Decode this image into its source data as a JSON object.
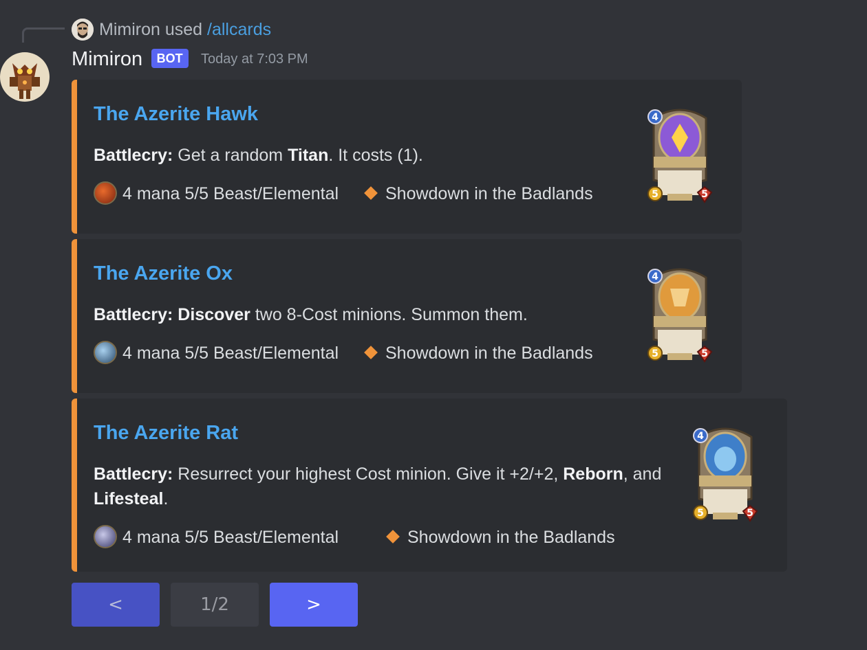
{
  "interaction": {
    "user_name": "Mimiron",
    "used_text": "used",
    "command": "/allcards"
  },
  "message": {
    "author": "Mimiron",
    "bot_tag": "BOT",
    "timestamp": "Today at 7:03 PM"
  },
  "colors": {
    "embed_accent": "#f0933a",
    "title_link": "#4aa6ef",
    "blurple": "#5865f2",
    "background": "#313338",
    "embed_bg": "#2b2d31"
  },
  "embeds": [
    {
      "title": "The Azerite Hawk",
      "desc_bold_1": "Battlecry:",
      "desc_text_1": " Get a random ",
      "desc_bold_2": "Titan",
      "desc_text_2": ". It costs (1).",
      "stats": "4 mana 5/5 Beast/Elemental",
      "set": "Showdown in the Badlands",
      "card": {
        "name": "The Azerite Hawk",
        "cost": "4",
        "attack": "5",
        "health": "5",
        "race": "Elemental Beast",
        "text": "Battlecry: Get a random Titan. It costs (1).",
        "art_color": "#8c5ad6"
      }
    },
    {
      "title": "The Azerite Ox",
      "desc_bold_1": "Battlecry: Discover",
      "desc_text_1": " two 8-Cost minions. Summon them.",
      "stats": "4 mana 5/5 Beast/Elemental",
      "set": "Showdown in the Badlands",
      "card": {
        "name": "The Azerite Ox",
        "cost": "4",
        "attack": "5",
        "health": "5",
        "race": "Elemental Beast",
        "text": "Battlecry: Discover two 8-Cost minions. Summon them.",
        "art_color": "#e09a3c"
      }
    },
    {
      "title": "The Azerite Rat",
      "desc_bold_1": "Battlecry:",
      "desc_text_1": " Resurrect your highest Cost minion. Give it +2/+2, ",
      "desc_bold_2": "Reborn",
      "desc_text_2": ", and ",
      "desc_bold_3": "Lifesteal",
      "desc_text_3": ".",
      "stats": "4 mana 5/5 Beast/Elemental",
      "set": "Showdown in the Badlands",
      "card": {
        "name": "The Azerite Rat",
        "cost": "4",
        "attack": "5",
        "health": "5",
        "race": "Elemental Beast",
        "text": "Battlecry: Resurrect your highest Cost minion. Give it +2/+2, Reborn, and Lifesteal.",
        "art_color": "#3f7fc9"
      }
    }
  ],
  "pagination": {
    "prev_label": "<",
    "page_label": "1/2",
    "next_label": ">"
  }
}
